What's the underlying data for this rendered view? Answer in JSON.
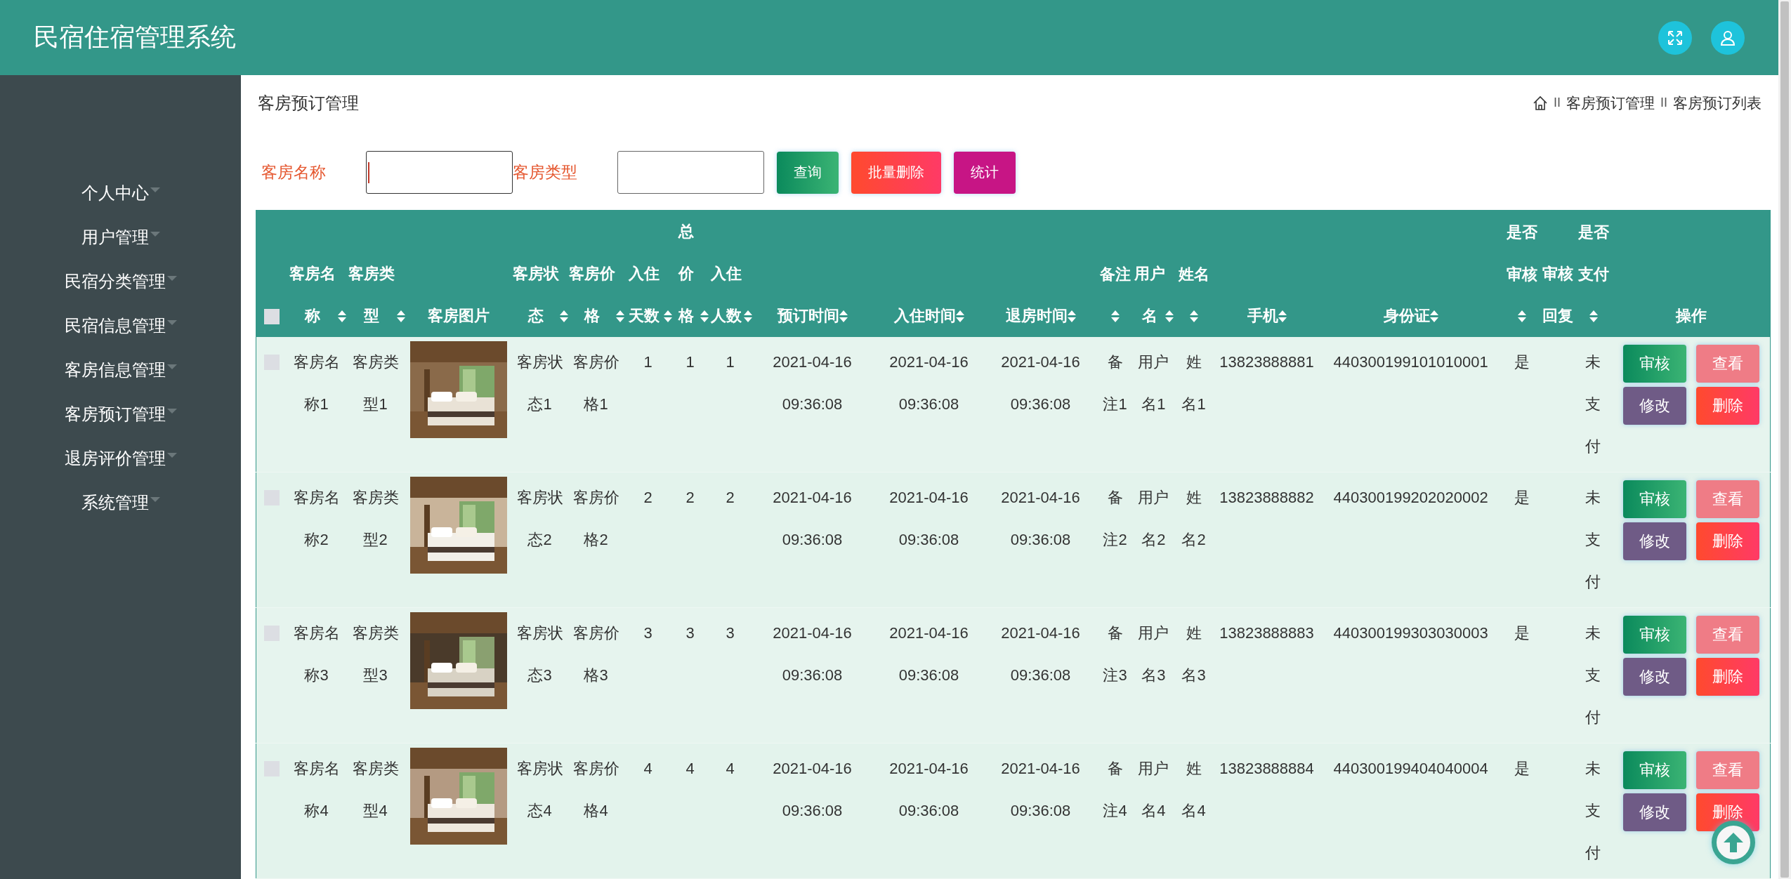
{
  "header": {
    "title": "民宿住宿管理系统"
  },
  "sidebar": {
    "items": [
      {
        "label": "个人中心"
      },
      {
        "label": "用户管理"
      },
      {
        "label": "民宿分类管理"
      },
      {
        "label": "民宿信息管理"
      },
      {
        "label": "客房信息管理"
      },
      {
        "label": "客房预订管理"
      },
      {
        "label": "退房评价管理"
      },
      {
        "label": "系统管理"
      }
    ]
  },
  "page_title": "客房预订管理",
  "breadcrumb": [
    {
      "kind": "separator",
      "text": "II"
    },
    {
      "kind": "link",
      "text": "客房预订管理"
    },
    {
      "kind": "separator",
      "text": "II"
    },
    {
      "kind": "link",
      "text": "客房预订列表"
    }
  ],
  "search": {
    "fields": [
      {
        "label": "客房名称",
        "focused": true
      },
      {
        "label": "客房类型",
        "focused": false
      }
    ],
    "buttons": [
      {
        "label": "查询",
        "kind": "query"
      },
      {
        "label": "批量删除",
        "kind": "delete"
      },
      {
        "label": "统计",
        "kind": "stats"
      }
    ]
  },
  "table": {
    "select_all": {
      "checked": false
    },
    "columns": [
      {
        "label": "客房名称",
        "sortable": true
      },
      {
        "label": "客房类型",
        "sortable": true
      },
      {
        "label": "客房图片",
        "sortable": false
      },
      {
        "label": "客房状态",
        "sortable": true
      },
      {
        "label": "客房价格",
        "sortable": true
      },
      {
        "label": "入住天数",
        "sortable": true
      },
      {
        "label": "总价格",
        "sortable": true
      },
      {
        "label": "入住人数",
        "sortable": true
      },
      {
        "label": "预订时间",
        "sortable": true
      },
      {
        "label": "入住时间",
        "sortable": true
      },
      {
        "label": "退房时间",
        "sortable": true
      },
      {
        "label": "备注",
        "sortable": true
      },
      {
        "label": "用户名",
        "sortable": true
      },
      {
        "label": "姓名",
        "sortable": true
      },
      {
        "label": "手机",
        "sortable": true
      },
      {
        "label": "身份证",
        "sortable": true
      },
      {
        "label": "是否审核",
        "sortable": true
      },
      {
        "label": "审核回复",
        "sortable": false
      },
      {
        "label": "是否支付",
        "sortable": true
      },
      {
        "label": "操作",
        "sortable": false
      }
    ],
    "rows": [
      {
        "checked": false,
        "cells": [
          "客房名称1",
          "客房类型1",
          {
            "kind": "picture"
          },
          "客房状态1",
          "客房价格1",
          "1",
          "1",
          "1",
          "2021-04-16 09:36:08",
          "2021-04-16 09:36:08",
          "2021-04-16 09:36:08",
          "备注1",
          "用户名1",
          "姓名1",
          "13823888881",
          "440300199101010001",
          "是",
          "",
          "未支付"
        ],
        "actions": [
          {
            "label": "审核",
            "kind": "approve"
          },
          {
            "label": "查看",
            "kind": "view"
          },
          {
            "label": "修改",
            "kind": "edit"
          },
          {
            "label": "删除",
            "kind": "delete"
          }
        ]
      },
      {
        "checked": false,
        "cells": [
          "客房名称2",
          "客房类型2",
          {
            "kind": "picture"
          },
          "客房状态2",
          "客房价格2",
          "2",
          "2",
          "2",
          "2021-04-16 09:36:08",
          "2021-04-16 09:36:08",
          "2021-04-16 09:36:08",
          "备注2",
          "用户名2",
          "姓名2",
          "13823888882",
          "440300199202020002",
          "是",
          "",
          "未支付"
        ],
        "actions": [
          {
            "label": "审核",
            "kind": "approve"
          },
          {
            "label": "查看",
            "kind": "view"
          },
          {
            "label": "修改",
            "kind": "edit"
          },
          {
            "label": "删除",
            "kind": "delete"
          }
        ]
      },
      {
        "checked": false,
        "cells": [
          "客房名称3",
          "客房类型3",
          {
            "kind": "picture"
          },
          "客房状态3",
          "客房价格3",
          "3",
          "3",
          "3",
          "2021-04-16 09:36:08",
          "2021-04-16 09:36:08",
          "2021-04-16 09:36:08",
          "备注3",
          "用户名3",
          "姓名3",
          "13823888883",
          "440300199303030003",
          "是",
          "",
          "未支付"
        ],
        "actions": [
          {
            "label": "审核",
            "kind": "approve"
          },
          {
            "label": "查看",
            "kind": "view"
          },
          {
            "label": "修改",
            "kind": "edit"
          },
          {
            "label": "删除",
            "kind": "delete"
          }
        ]
      },
      {
        "checked": false,
        "cells": [
          "客房名称4",
          "客房类型4",
          {
            "kind": "picture"
          },
          "客房状态4",
          "客房价格4",
          "4",
          "4",
          "4",
          "2021-04-16 09:36:08",
          "2021-04-16 09:36:08",
          "2021-04-16 09:36:08",
          "备注4",
          "用户名4",
          "姓名4",
          "13823888884",
          "440300199404040004",
          "是",
          "",
          "未支付"
        ],
        "actions": [
          {
            "label": "审核",
            "kind": "approve"
          },
          {
            "label": "查看",
            "kind": "view"
          },
          {
            "label": "修改",
            "kind": "edit"
          },
          {
            "label": "删除",
            "kind": "delete"
          }
        ]
      }
    ]
  }
}
